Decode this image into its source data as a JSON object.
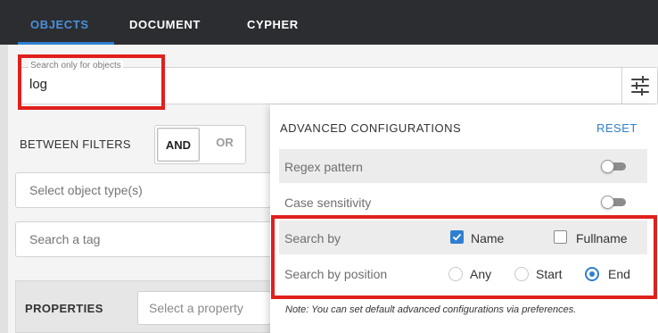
{
  "tabs": [
    {
      "label": "OBJECTS",
      "active": true
    },
    {
      "label": "DOCUMENT",
      "active": false
    },
    {
      "label": "CYPHER",
      "active": false
    }
  ],
  "search": {
    "label": "Search only for objects",
    "value": "log",
    "filter_icon": "tune-sliders-icon"
  },
  "filters": {
    "between_label": "BETWEEN FILTERS",
    "and_label": "AND",
    "or_label": "OR",
    "selected": "AND",
    "object_type_placeholder": "Select object type(s)",
    "tag_placeholder": "Search a tag"
  },
  "properties": {
    "label": "PROPERTIES",
    "select_placeholder": "Select a property"
  },
  "advanced": {
    "title": "ADVANCED CONFIGURATIONS",
    "reset_label": "RESET",
    "regex": {
      "label": "Regex pattern",
      "enabled": false
    },
    "case": {
      "label": "Case sensitivity",
      "enabled": false
    },
    "search_by": {
      "label": "Search by",
      "options": [
        {
          "label": "Name",
          "checked": true
        },
        {
          "label": "Fullname",
          "checked": false
        }
      ]
    },
    "position": {
      "label": "Search by position",
      "options": [
        {
          "label": "Any",
          "selected": false
        },
        {
          "label": "Start",
          "selected": false
        },
        {
          "label": "End",
          "selected": true
        }
      ]
    },
    "note": "Note: You can set default advanced configurations via preferences."
  },
  "colors": {
    "accent": "#2f7fd0",
    "highlight": "#e0201c",
    "topbar": "#2b2d31"
  }
}
